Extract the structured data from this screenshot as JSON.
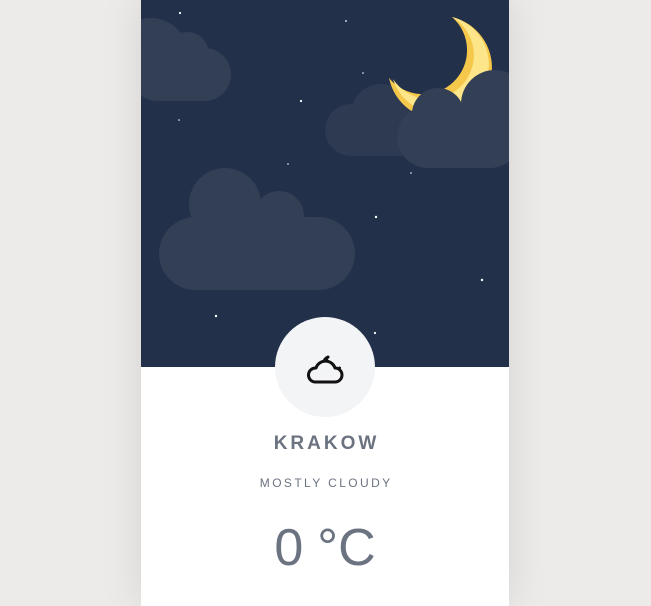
{
  "weather": {
    "city": "KRAKOW",
    "condition": "MOSTLY CLOUDY",
    "temperature": "0",
    "unit": "°C",
    "icon": "cloud-moon-icon"
  },
  "scene": {
    "sky_color": "#23304a",
    "cloud_color": "#333f55",
    "moon_color": "#fde68a",
    "moon_shade_color": "#f5c84c",
    "star_color": "#ffffff"
  },
  "colors": {
    "page_background": "#edebe9",
    "card_background": "#ffffff",
    "badge_background": "#f3f4f6",
    "text_color": "#6b7280",
    "icon_color": "#111111"
  }
}
